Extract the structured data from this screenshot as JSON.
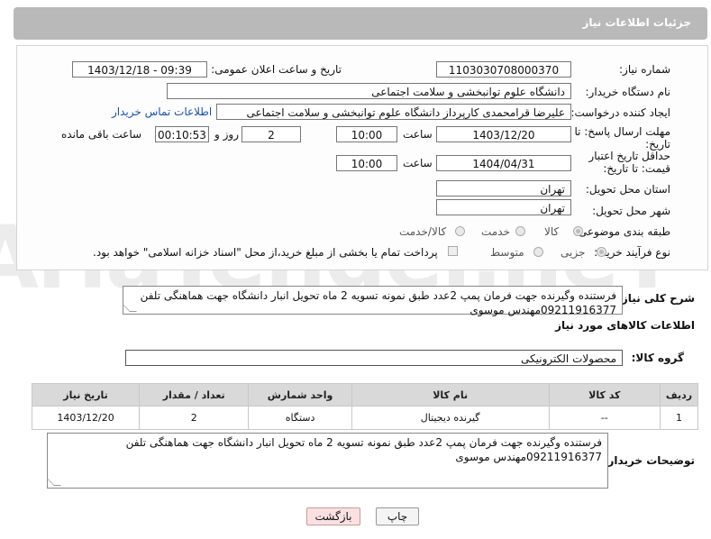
{
  "header": {
    "title": "جزئیات اطلاعات نیاز"
  },
  "form": {
    "need_number": {
      "label": "شماره نیاز:",
      "value": "1103030708000370"
    },
    "announce": {
      "label": "تاریخ و ساعت اعلان عمومی:",
      "value": "1403/12/18 - 09:39"
    },
    "buyer_org": {
      "label": "نام دستگاه خریدار:",
      "value": "دانشگاه علوم توانبخشی و سلامت اجتماعی"
    },
    "creator": {
      "label": "ایجاد کننده درخواست:",
      "value": "علیرضا قرامحمدی کارپرداز دانشگاه علوم توانبخشی و سلامت اجتماعی",
      "contact_link": "اطلاعات تماس خریدار"
    },
    "deadline": {
      "label": "مهلت ارسال پاسخ: تا تاریخ:",
      "date": "1403/12/20",
      "time_label": "ساعت",
      "time": "10:00",
      "days": "2",
      "days_label": "روز و",
      "remaining": "00:10:53",
      "remaining_label": "ساعت باقی مانده"
    },
    "validity": {
      "label": "حداقل تاریخ اعتبار قیمت: تا تاریخ:",
      "date": "1404/04/31",
      "time_label": "ساعت",
      "time": "10:00"
    },
    "province": {
      "label": "استان محل تحویل:",
      "value": "تهران"
    },
    "city": {
      "label": "شهر محل تحویل:",
      "value": "تهران"
    },
    "category": {
      "label": "طبقه بندی موضوعی:",
      "options": [
        "کالا",
        "خدمت",
        "کالا/خدمت"
      ],
      "selected": "کالا"
    },
    "process": {
      "label": "نوع فرآیند خرید :",
      "options": [
        "جزیی",
        "متوسط"
      ],
      "selected": "جزیی",
      "note": "پرداخت تمام یا بخشی از مبلغ خرید،از محل \"اسناد خزانه اسلامی\" خواهد بود."
    }
  },
  "description": {
    "label": "شرح کلی نیاز:",
    "text": "فرستنده وگیرنده جهت فرمان پمپ 2عدد طبق نمونه تسویه 2 ماه تحویل انبار دانشگاه جهت هماهنگی تلفن 09211916377مهندس موسوی"
  },
  "goods_section": {
    "title": "اطلاعات کالاهای مورد نیاز"
  },
  "goods_group": {
    "label": "گروه کالا:",
    "value": "محصولات الکترونیکی"
  },
  "table": {
    "headers": [
      "ردیف",
      "کد کالا",
      "نام کالا",
      "واحد شمارش",
      "تعداد / مقدار",
      "تاریخ نیاز"
    ],
    "rows": [
      [
        "1",
        "--",
        "گیرنده دیجیتال",
        "دستگاه",
        "2",
        "1403/12/20"
      ]
    ]
  },
  "buyer_notes": {
    "label": "توضیحات خریدار:",
    "text": "فرستنده وگیرنده جهت فرمان پمپ 2عدد طبق نمونه تسویه 2 ماه تحویل انبار دانشگاه جهت هماهنگی تلفن 09211916377مهندس موسوی"
  },
  "buttons": {
    "print": "چاپ",
    "back": "بازگشت"
  },
  "watermark": "AriaTender.neT",
  "colors": {
    "header_bg": "#b9b9b9",
    "link": "#1a4fb0",
    "back_button_bg": "#f9e1e1"
  }
}
